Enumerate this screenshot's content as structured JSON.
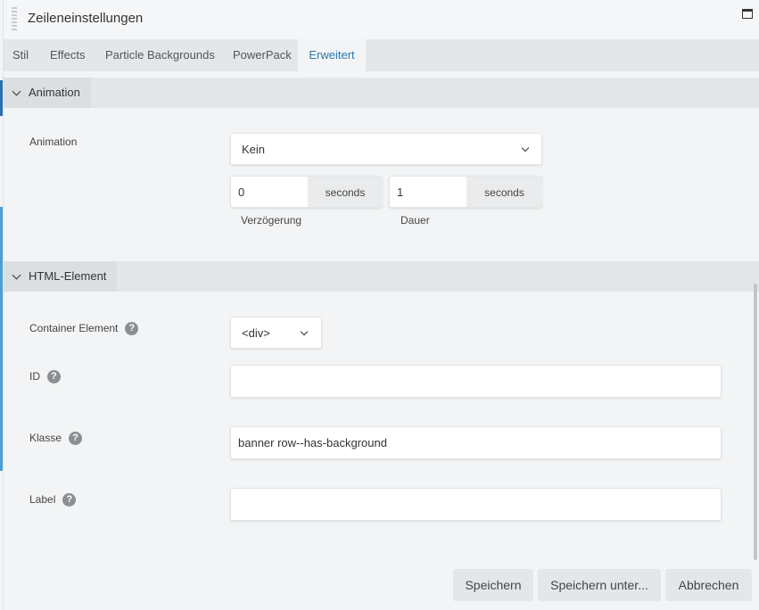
{
  "window": {
    "title": "Zeileneinstellungen"
  },
  "tabs": [
    {
      "label": "Stil"
    },
    {
      "label": "Effects"
    },
    {
      "label": "Particle Backgrounds"
    },
    {
      "label": "PowerPack"
    },
    {
      "label": "Erweitert",
      "active": true
    }
  ],
  "animation_section": {
    "title": "Animation",
    "animation_label": "Animation",
    "animation_value": "Kein",
    "delay_value": "0",
    "delay_unit": "seconds",
    "delay_label": "Verzögerung",
    "duration_value": "1",
    "duration_unit": "seconds",
    "duration_label": "Dauer"
  },
  "html_section": {
    "title": "HTML-Element",
    "container_label": "Container Element",
    "container_value": "<div>",
    "id_label": "ID",
    "id_value": "",
    "class_label": "Klasse",
    "class_value": "banner row--has-background",
    "label_label": "Label",
    "label_value": "",
    "help_glyph": "?"
  },
  "footer": {
    "save": "Speichern",
    "save_as": "Speichern unter...",
    "cancel": "Abbrechen"
  },
  "colors": {
    "accent": "#2b7ab0",
    "edge_blue": "#4d9fd6"
  },
  "icons": {
    "drag": "drag-handle-icon",
    "maximize": "maximize-icon",
    "chevron": "chevron-down-icon",
    "help": "help-icon"
  }
}
